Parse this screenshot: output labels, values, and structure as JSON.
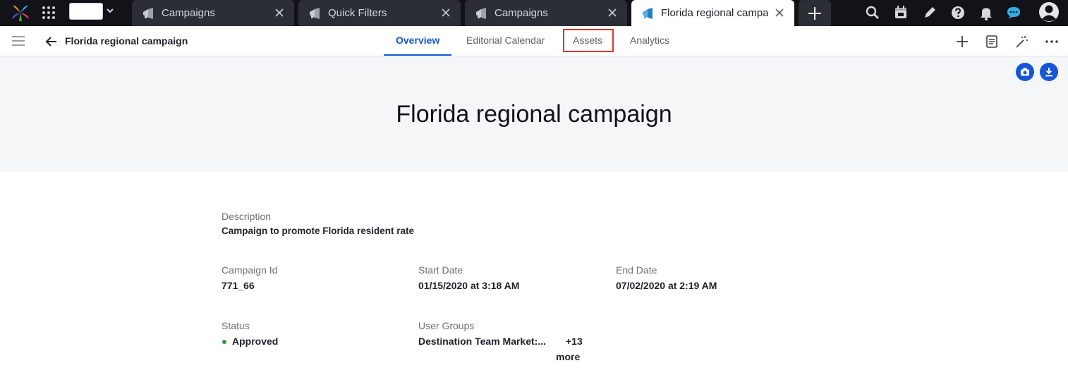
{
  "tabs": [
    {
      "label": "Campaigns",
      "icon": "megaphone-icon",
      "active": false
    },
    {
      "label": "Quick Filters",
      "icon": "megaphone-icon",
      "active": false
    },
    {
      "label": "Campaigns",
      "icon": "megaphone-icon",
      "active": false
    },
    {
      "label": "Florida regional campai",
      "icon": "megaphone-icon",
      "active": true
    }
  ],
  "header": {
    "record_title": "Florida regional campaign",
    "nav_tabs": [
      {
        "label": "Overview",
        "active": true
      },
      {
        "label": "Editorial Calendar",
        "active": false
      },
      {
        "label": "Assets",
        "active": false,
        "highlighted": true
      },
      {
        "label": "Analytics",
        "active": false
      }
    ]
  },
  "banner": {
    "title": "Florida regional campaign"
  },
  "details": {
    "description": {
      "label": "Description",
      "value": "Campaign to promote Florida resident rate"
    },
    "campaign_id": {
      "label": "Campaign Id",
      "value": "771_66"
    },
    "start_date": {
      "label": "Start Date",
      "value": "01/15/2020 at 3:18 AM"
    },
    "end_date": {
      "label": "End Date",
      "value": "07/02/2020 at 2:19 AM"
    },
    "status": {
      "label": "Status",
      "value": "Approved",
      "color": "#2e9a3e"
    },
    "user_groups": {
      "label": "User Groups",
      "value": "Destination Team Market:...",
      "more_count": "+13",
      "more_label": "more"
    }
  },
  "colors": {
    "accent": "#1556d6",
    "highlight_border": "#e0372a",
    "topbar_bg": "#111318"
  }
}
